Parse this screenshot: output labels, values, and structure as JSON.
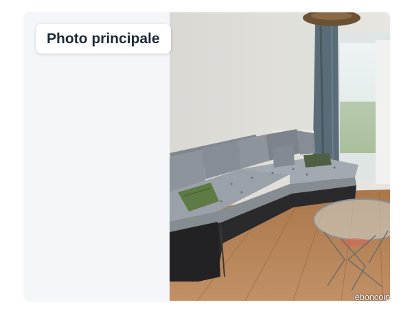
{
  "badge": {
    "label": "Photo principale"
  },
  "watermark": {
    "text": "leboncoin"
  },
  "photo": {
    "subject_icon": "living-room-photo"
  },
  "colors": {
    "badge_text": "#1a2a3a",
    "panel_bg": "#f4f6f9",
    "sofa": "#8a9097",
    "sofa_base": "#2a2a2c",
    "cushion": "#5e7a45",
    "floor": "#b07f52",
    "curtain": "#5b6c79"
  }
}
